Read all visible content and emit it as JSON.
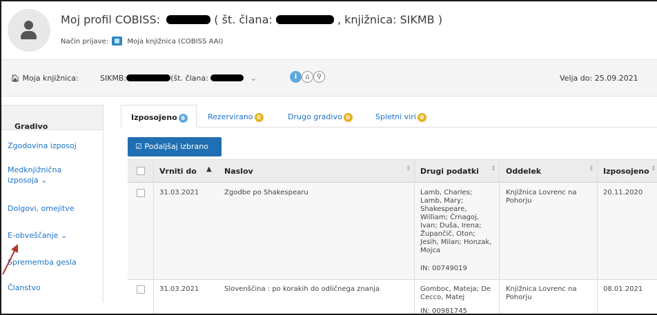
{
  "header": {
    "title_prefix": "Moj profil COBISS:",
    "title_mid": "( št. člana:",
    "title_suffix": ", knjižnica: SIKMB )",
    "login_label": "Način prijave:",
    "login_value": "Moja knjižnica (COBISS AAI)"
  },
  "library_bar": {
    "label": "Moja knjižnica:",
    "select_prefix": "SIKMB:",
    "select_mid": "(št. člana:",
    "valid_until": "Velja do: 25.09.2021",
    "info_icon": "i",
    "home_icon": "⌂",
    "pin_icon": "⚲"
  },
  "sidebar": {
    "heading": "Gradivo",
    "items": [
      {
        "label": "Zgodovina izposoj"
      },
      {
        "label": "Medknjižnična\nizposoja"
      },
      {
        "label": "Dolgovi, omejitve"
      },
      {
        "label": "E-obveščanje"
      },
      {
        "label": "Sprememba gesla"
      },
      {
        "label": "Članstvo"
      }
    ]
  },
  "tabs": [
    {
      "label": "Izposojeno",
      "count": "6"
    },
    {
      "label": "Rezervirano",
      "count": "0"
    },
    {
      "label": "Drugo gradivo",
      "count": "0"
    },
    {
      "label": "Spletni viri",
      "count": "0"
    }
  ],
  "button": {
    "label": "Podaljšaj izbrano"
  },
  "table": {
    "columns": [
      "Vrniti do",
      "Naslov",
      "Drugi podatki",
      "Oddelek",
      "Izposojeno"
    ],
    "rows": [
      {
        "due": "31.03.2021",
        "title": "Zgodbe po Shakespearu",
        "other": "Lamb, Charles;\nLamb, Mary;\nShakespeare,\nWilliam; Črnagoj,\nIvan; Duša, Irena;\nŽupančič, Oton;\nJesih, Milan; Honzak,\nMojca",
        "in": "IN: 00749019",
        "dept": "Knjižnica Lovrenc na\nPohorju",
        "borrowed": "20.11.2020"
      },
      {
        "due": "31.03.2021",
        "title": "Slovenščina : po korakih do odličnega znanja",
        "other": "Gomboc, Mateja; De\nCecco, Matej",
        "in": "IN: 00981745",
        "dept": "Knjižnica Lovrenc na\nPohorju",
        "borrowed": "08.01.2021"
      }
    ]
  },
  "colors": {
    "link": "#1a73c8",
    "button": "#1f6fb2",
    "badge_blue": "#5fa8dd",
    "badge_gold": "#e6b422",
    "arrow": "#b03a2e"
  }
}
